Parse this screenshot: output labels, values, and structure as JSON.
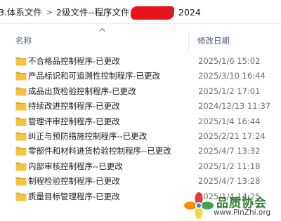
{
  "breadcrumb": {
    "items": [
      "3.体系文件",
      "2级文件--程序文件",
      "2024"
    ],
    "separator": ">"
  },
  "columns": {
    "name": "名称",
    "modified": "修改日期"
  },
  "files": [
    {
      "name": "不合格品控制程序-已更改",
      "modified": "2025/1/6 15:02"
    },
    {
      "name": "产品标识和可追溯性控制程序-已更改",
      "modified": "2025/3/10 16:44"
    },
    {
      "name": "成品出货检验控制程序-已更改",
      "modified": "2025/1/2 17:01"
    },
    {
      "name": "持续改进控制程序-已更改",
      "modified": "2024/12/13 11:37"
    },
    {
      "name": "管理评审控制程序-已更改",
      "modified": "2025/1/4 16:44"
    },
    {
      "name": "纠正与预防措施控制程序--已更改",
      "modified": "2025/2/21 17:24"
    },
    {
      "name": "零部件和材料进货检验控制程序--已更改",
      "modified": "2025/4/7 13:32"
    },
    {
      "name": "内部审核控制程序--已更改",
      "modified": "2025/1/2 11:18"
    },
    {
      "name": "制程检验控制程序-已更改",
      "modified": "2025/4/7 13:28"
    },
    {
      "name": "质量目标管理程序-已更改",
      "modified": "2025/1/4 14:25"
    }
  ],
  "watermark": {
    "name": "品质协会",
    "url": "www.PinZhi.org"
  },
  "colors": {
    "folder": "#f5c342",
    "folder_dark": "#e0a82e",
    "redaction": "#e8141c",
    "header_text": "#4c607a"
  },
  "icons": [
    "folder-icon",
    "sort-up-icon",
    "chevron-right-icon"
  ]
}
